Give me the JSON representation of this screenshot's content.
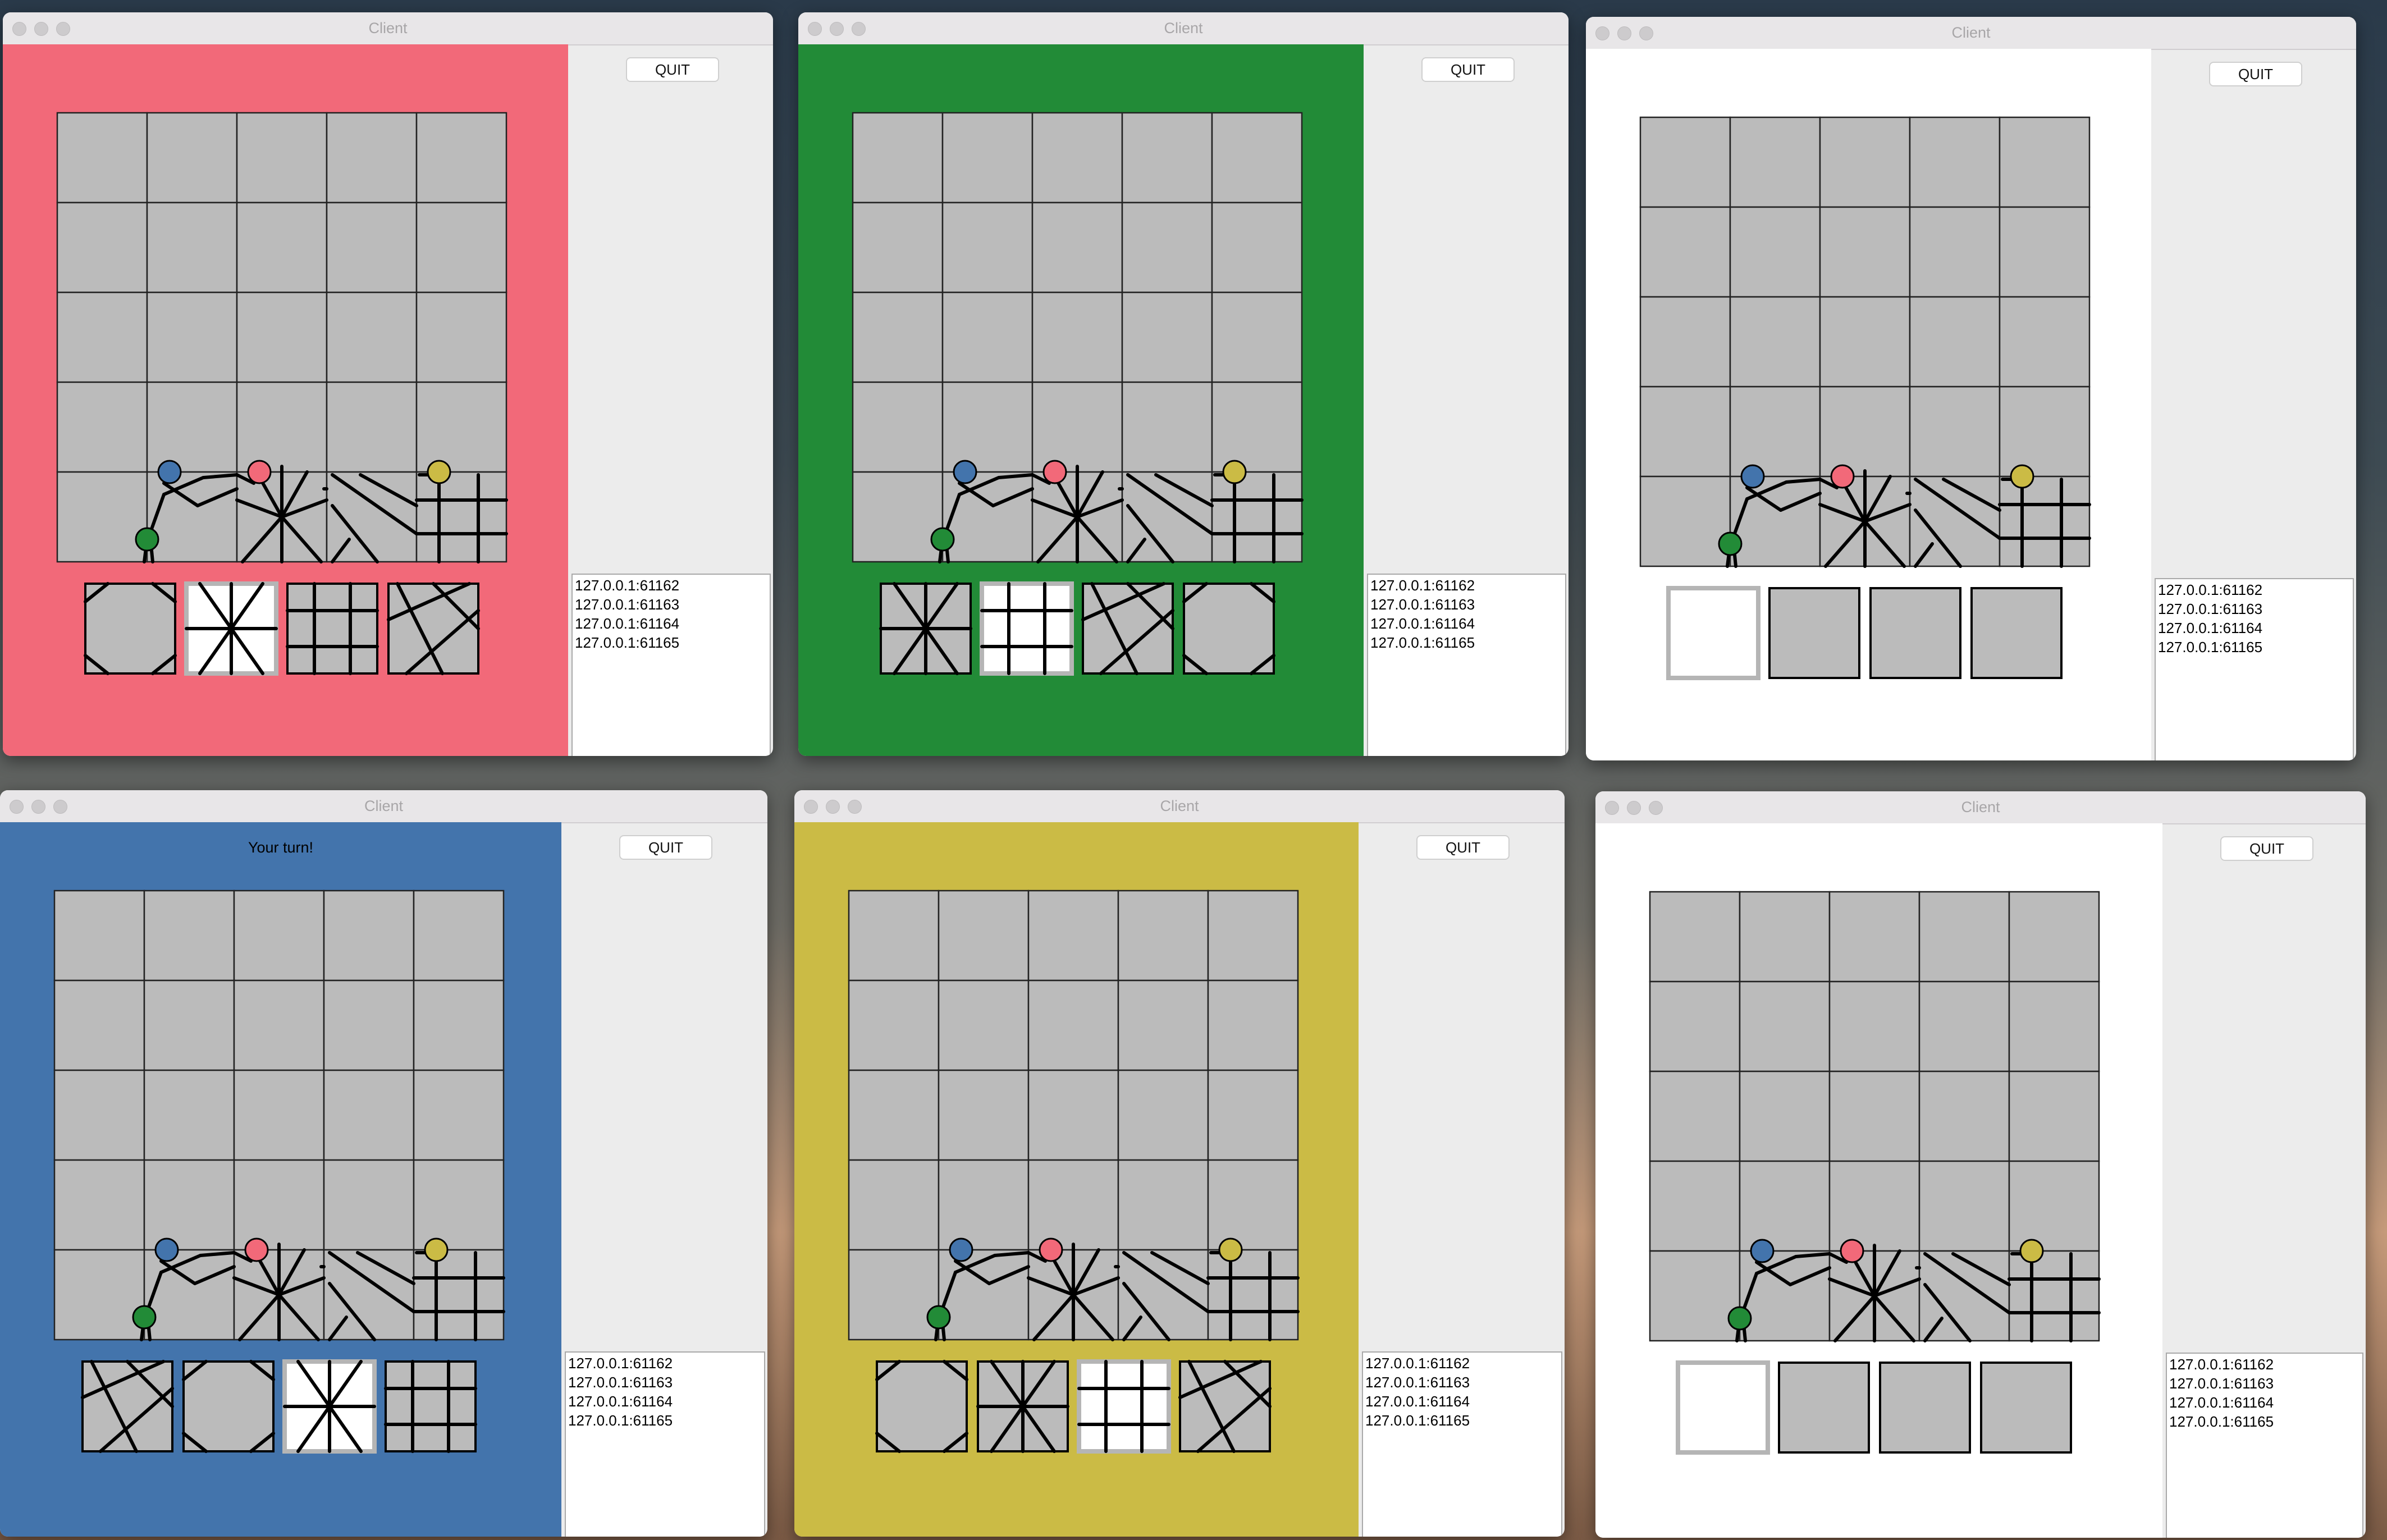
{
  "app": {
    "window_title": "Client",
    "quit_label": "QUIT"
  },
  "connections": [
    "127.0.0.1:61162",
    "127.0.0.1:61163",
    "127.0.0.1:61164",
    "127.0.0.1:61165"
  ],
  "colors": {
    "red_player": "#f26979",
    "green_player": "#228b37",
    "blue_player": "#4374ac",
    "yellow_player": "#cbbb45",
    "spectator": "#ffffff",
    "tile": "#bbbbbb",
    "selected_tile": "#ffffff"
  },
  "windows": [
    {
      "name": "window-red-player",
      "player_color": "red_player",
      "status": "",
      "hand": [
        "path-tile",
        "selected-tile",
        "path-tile",
        "path-tile"
      ]
    },
    {
      "name": "window-green-player",
      "player_color": "green_player",
      "status": "",
      "hand": [
        "path-tile",
        "selected-tile",
        "path-tile",
        "path-tile"
      ]
    },
    {
      "name": "window-spectator-1",
      "player_color": "spectator",
      "status": "",
      "hand": [
        "selected-tile",
        "blank-tile",
        "blank-tile",
        "blank-tile"
      ]
    },
    {
      "name": "window-blue-player",
      "player_color": "blue_player",
      "status": "Your turn!",
      "hand": [
        "path-tile",
        "path-tile",
        "selected-tile",
        "path-tile"
      ]
    },
    {
      "name": "window-yellow-player",
      "player_color": "yellow_player",
      "status": "",
      "hand": [
        "path-tile",
        "path-tile",
        "selected-tile",
        "path-tile"
      ]
    },
    {
      "name": "window-spectator-2",
      "player_color": "spectator",
      "status": "",
      "hand": [
        "selected-tile",
        "blank-tile",
        "blank-tile",
        "blank-tile"
      ]
    }
  ],
  "tokens": [
    {
      "name": "blue-token",
      "color": "blue_player"
    },
    {
      "name": "red-token",
      "color": "red_player"
    },
    {
      "name": "yellow-token",
      "color": "yellow_player"
    },
    {
      "name": "green-token",
      "color": "green_player"
    }
  ]
}
